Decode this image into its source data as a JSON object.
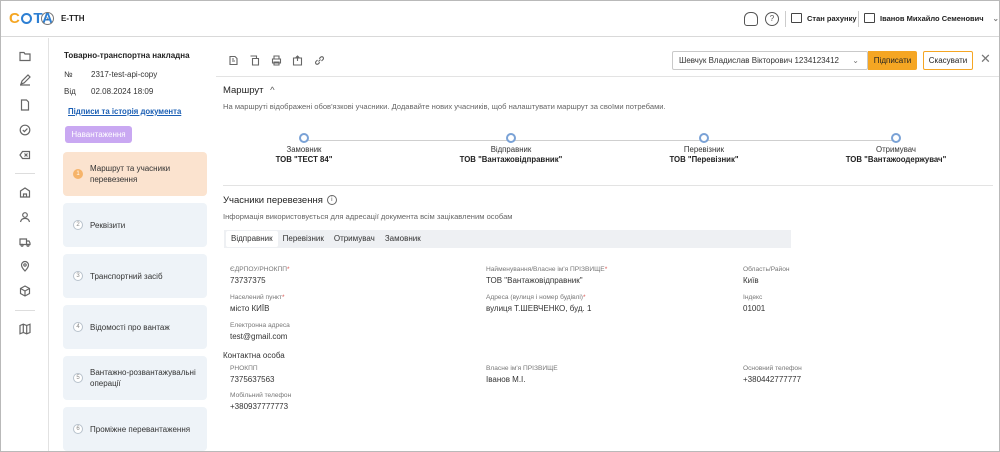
{
  "app": {
    "logo_left": "С",
    "logo_right": "ТА",
    "logo_btn": "›",
    "title": "Е-ТТН",
    "support_icon": "headset-icon",
    "help_icon": "question-icon",
    "account_label": "Стан рахунку",
    "user_name": "Іванов Михайло Семенович",
    "user_chevron": "⌄"
  },
  "document": {
    "title": "Товарно-транспортна накладна",
    "number_key": "№",
    "number_value": "2317-test-api-copy",
    "date_key": "Від",
    "date_value": "02.08.2024 18:09",
    "history_link": "Підписи та історія документа",
    "badge": "Навантаження"
  },
  "steps": [
    {
      "num": "1",
      "label": "Маршрут та учасники перевезення"
    },
    {
      "num": "2",
      "label": "Реквізити"
    },
    {
      "num": "3",
      "label": "Транспортний засіб"
    },
    {
      "num": "4",
      "label": "Відомості про вантаж"
    },
    {
      "num": "5",
      "label": "Вантажно-розвантажувальні операції"
    },
    {
      "num": "6",
      "label": "Проміжне перевантаження"
    }
  ],
  "toolbar": {
    "signer_value": "Шевчук Владислав Вікторович 1234123412",
    "sign_label": "Підписати",
    "cancel_label": "Скасувати",
    "close_glyph": "✕",
    "chev": "⌄"
  },
  "route": {
    "title": "Маршрут",
    "chevron": "^",
    "hint": "На маршруті відображені обов'язкові учасники. Додавайте нових учасників, щоб налаштувати маршрут за своїми потребами.",
    "points": [
      {
        "role": "Замовник",
        "org": "ТОВ \"ТЕСТ 84\""
      },
      {
        "role": "Відправник",
        "org": "ТОВ \"Вантажовідправник\""
      },
      {
        "role": "Перевізник",
        "org": "ТОВ \"Перевізник\""
      },
      {
        "role": "Отримувач",
        "org": "ТОВ \"Вантажоодержувач\""
      }
    ]
  },
  "participants": {
    "title": "Учасники перевезення",
    "info_glyph": "i",
    "hint": "Інформація використовується для адресації документа всім зацікавленим особам",
    "tabs": [
      "Відправник",
      "Перевізник",
      "Отримувач",
      "Замовник"
    ],
    "fields": {
      "edrpou_label": "ЄДРПОУ/РНОКПП",
      "edrpou_value": "73737375",
      "name_label": "Найменування/Власне ім'я ПРІЗВИЩЕ",
      "name_value": "ТОВ \"Вантажовідправник\"",
      "region_label": "Область/Район",
      "region_value": "Київ",
      "city_label": "Населений пункт",
      "city_value": "місто КИЇВ",
      "address_label": "Адреса (вулиця і номер будівлі)",
      "address_value": "вулиця Т.ШЕВЧЕНКО, буд. 1",
      "index_label": "Індекс",
      "index_value": "01001",
      "email_label": "Електронна адреса",
      "email_value": "test@gmail.com",
      "req_mark": "*"
    },
    "contact_title": "Контактна особа",
    "contact": {
      "rnokpp_label": "РНОКПП",
      "rnokpp_value": "7375637563",
      "name_label": "Власне ім'я ПРІЗВИЩЕ",
      "name_value": "Іванов М.І.",
      "phone_label": "Основний телефон",
      "phone_value": "+380442777777",
      "mobile_label": "Мобільний телефон",
      "mobile_value": "+380937777773"
    }
  }
}
